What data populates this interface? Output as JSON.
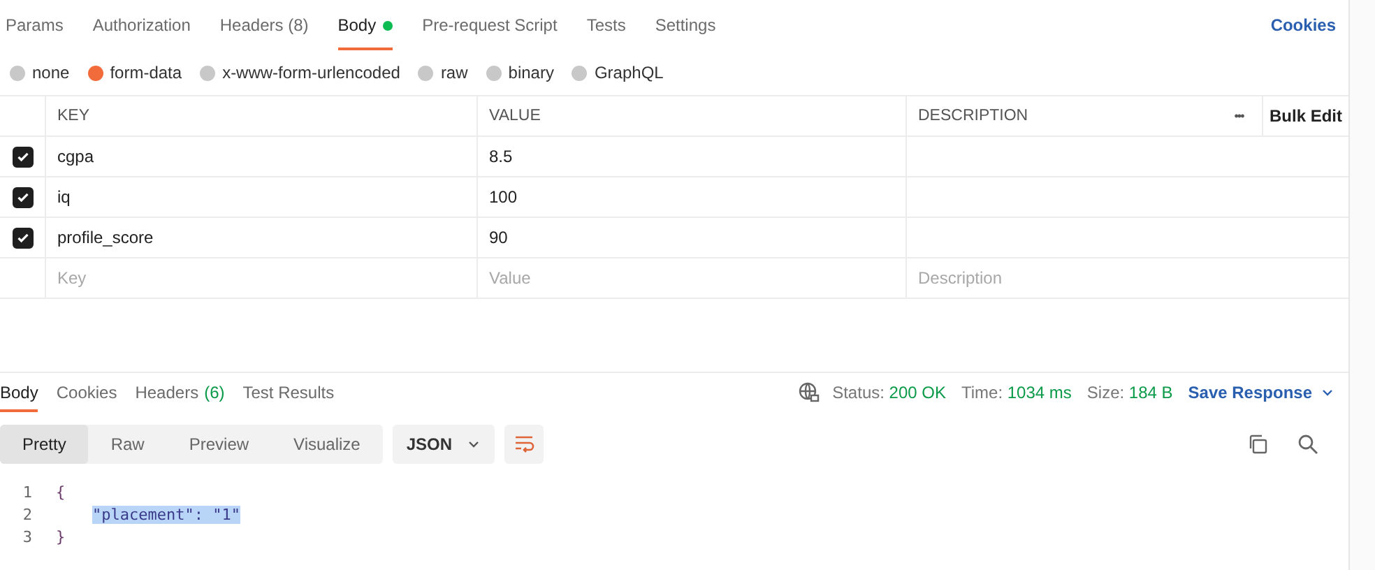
{
  "request_tabs": [
    {
      "label": "Params",
      "selected": false,
      "dot": false
    },
    {
      "label": "Authorization",
      "selected": false,
      "dot": false
    },
    {
      "label": "Headers (8)",
      "selected": false,
      "dot": false
    },
    {
      "label": "Body",
      "selected": true,
      "dot": true
    },
    {
      "label": "Pre-request Script",
      "selected": false,
      "dot": false
    },
    {
      "label": "Tests",
      "selected": false,
      "dot": false
    },
    {
      "label": "Settings",
      "selected": false,
      "dot": false
    }
  ],
  "cookies_link": "Cookies",
  "body_types": [
    {
      "label": "none",
      "selected": false
    },
    {
      "label": "form-data",
      "selected": true
    },
    {
      "label": "x-www-form-urlencoded",
      "selected": false
    },
    {
      "label": "raw",
      "selected": false
    },
    {
      "label": "binary",
      "selected": false
    },
    {
      "label": "GraphQL",
      "selected": false
    }
  ],
  "params_table": {
    "columns": [
      "KEY",
      "VALUE",
      "DESCRIPTION"
    ],
    "more": "•••",
    "bulk_edit": "Bulk Edit",
    "rows": [
      {
        "checked": true,
        "key": "cgpa",
        "value": "8.5"
      },
      {
        "checked": true,
        "key": "iq",
        "value": "100"
      },
      {
        "checked": true,
        "key": "profile_score",
        "value": "90"
      }
    ],
    "new_row": {
      "key_placeholder": "Key",
      "value_placeholder": "Value",
      "description_placeholder": "Description"
    }
  },
  "response": {
    "tabs": [
      {
        "label": "Body",
        "selected": true
      },
      {
        "label": "Cookies",
        "selected": false
      },
      {
        "label": "Headers",
        "count": "(6)",
        "selected": false
      },
      {
        "label": "Test Results",
        "selected": false
      }
    ],
    "status": {
      "label": "Status:",
      "value": "200 OK"
    },
    "time": {
      "label": "Time:",
      "value": "1034 ms"
    },
    "size": {
      "label": "Size:",
      "value": "184 B"
    },
    "save_button": "Save Response",
    "view_modes": [
      {
        "label": "Pretty",
        "selected": true
      },
      {
        "label": "Raw",
        "selected": false
      },
      {
        "label": "Preview",
        "selected": false
      },
      {
        "label": "Visualize",
        "selected": false
      }
    ],
    "format": "JSON",
    "code_lines": [
      {
        "number": "1",
        "text": "{",
        "selected": false
      },
      {
        "number": "2",
        "text": "\"placement\": \"1\"",
        "selected": true
      },
      {
        "number": "3",
        "text": "}",
        "selected": false
      }
    ]
  }
}
